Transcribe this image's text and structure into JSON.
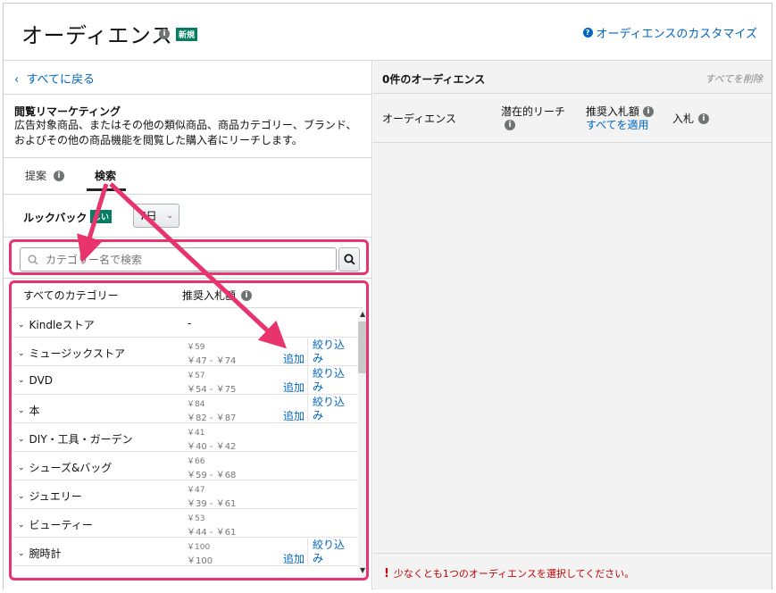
{
  "header": {
    "title": "オーディエンス",
    "new_badge": "新規",
    "customize_link": "オーディエンスのカスタマイズ"
  },
  "left": {
    "back_link": "すべてに戻る",
    "section_title": "閲覧リマーケティング",
    "section_desc": "広告対象商品、またはその他の類似商品、商品カテゴリー、ブランド、およびその他の商品機能を閲覧した購入者にリーチします。",
    "tabs": [
      {
        "label": "提案"
      },
      {
        "label": "検索"
      }
    ],
    "lookback_label": "ルックバック",
    "lookback_badge": "しい",
    "lookback_value": "7日",
    "search_placeholder": "カテゴリー名で検索",
    "table": {
      "col_category": "すべてのカテゴリー",
      "col_bid": "推奨入札額",
      "rows": [
        {
          "name": "Kindleストア",
          "dash": "-",
          "bid": "",
          "range": "",
          "add": "",
          "filter": ""
        },
        {
          "name": "ミュージックストア",
          "dash": "",
          "bid": "￥59",
          "range": "￥47 - ￥74",
          "add": "追加",
          "filter": "絞り込み"
        },
        {
          "name": "DVD",
          "dash": "",
          "bid": "￥57",
          "range": "￥54 - ￥75",
          "add": "追加",
          "filter": "絞り込み"
        },
        {
          "name": "本",
          "dash": "",
          "bid": "￥84",
          "range": "￥82 - ￥87",
          "add": "追加",
          "filter": "絞り込み"
        },
        {
          "name": "DIY・工具・ガーデン",
          "dash": "",
          "bid": "￥41",
          "range": "￥40 - ￥42",
          "add": "",
          "filter": ""
        },
        {
          "name": "シューズ&バッグ",
          "dash": "",
          "bid": "￥66",
          "range": "￥59 - ￥68",
          "add": "",
          "filter": ""
        },
        {
          "name": "ジュエリー",
          "dash": "",
          "bid": "￥47",
          "range": "￥39 - ￥61",
          "add": "",
          "filter": ""
        },
        {
          "name": "ビューティー",
          "dash": "",
          "bid": "￥53",
          "range": "￥44 - ￥61",
          "add": "",
          "filter": ""
        },
        {
          "name": "腕時計",
          "dash": "",
          "bid": "￥100",
          "range": "￥100",
          "add": "追加",
          "filter": "絞り込み"
        }
      ]
    }
  },
  "right": {
    "title": "0件のオーディエンス",
    "clear_all": "すべてを削除",
    "col_audience": "オーディエンス",
    "col_reach": "潜在的リーチ",
    "col_bid": "推奨入札額",
    "apply_all": "すべてを適用",
    "col_input_bid": "入札",
    "warning": "少なくとも1つのオーディエンスを選択してください。"
  },
  "colors": {
    "highlight": "#e8336d",
    "link": "#0066c0",
    "badge": "#067d62",
    "warning": "#c40000"
  },
  "icons": [
    "info-icon",
    "help-icon",
    "search-icon",
    "chevron-down-icon",
    "chevron-left-icon",
    "warning-icon"
  ]
}
